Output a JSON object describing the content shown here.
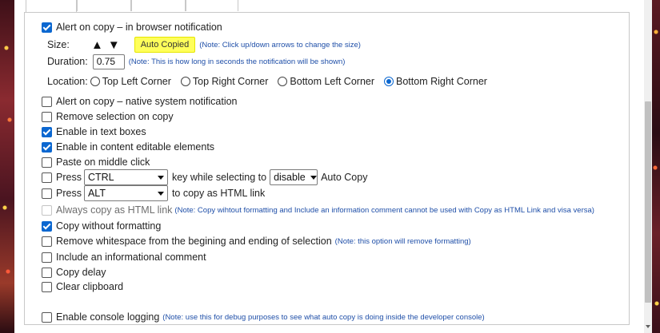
{
  "options": {
    "alert_on_copy_browser": {
      "label": "Alert on copy – in browser notification",
      "checked": true
    },
    "size": {
      "label": "Size:",
      "up_arrow": "▲",
      "down_arrow": "▼",
      "preview_label": "Auto Copied",
      "note": "(Note: Click up/down arrows to change the size)"
    },
    "duration": {
      "label": "Duration:",
      "value": "0.75",
      "note": "(Note: This is how long in seconds the notification will be shown)"
    },
    "location": {
      "label": "Location:",
      "options": [
        {
          "label": "Top Left Corner",
          "selected": false
        },
        {
          "label": "Top Right Corner",
          "selected": false
        },
        {
          "label": "Bottom Left Corner",
          "selected": false
        },
        {
          "label": "Bottom Right Corner",
          "selected": true
        }
      ]
    },
    "alert_on_copy_native": {
      "label": "Alert on copy – native system notification",
      "checked": false
    },
    "remove_selection": {
      "label": "Remove selection on copy",
      "checked": false
    },
    "enable_text_boxes": {
      "label": "Enable in text boxes",
      "checked": true
    },
    "enable_content_editable": {
      "label": "Enable in content editable elements",
      "checked": true
    },
    "paste_middle_click": {
      "label": "Paste on middle click",
      "checked": false
    },
    "press_key_while_selecting": {
      "checked": false,
      "press_label": "Press",
      "key_value": "CTRL",
      "middle_label": "key while selecting to",
      "action_value": "disable",
      "suffix_label": "Auto Copy"
    },
    "press_copy_html": {
      "checked": false,
      "press_label": "Press",
      "key_value": "ALT",
      "suffix_label": "to copy as HTML link"
    },
    "always_copy_html": {
      "label": "Always copy as HTML link",
      "checked": false,
      "disabled": true,
      "note": "(Note: Copy wihtout formatting and Include an information comment cannot be used with Copy as HTML Link and visa versa)"
    },
    "copy_without_formatting": {
      "label": "Copy without formatting",
      "checked": true
    },
    "remove_whitespace": {
      "label": "Remove whitespace from the begining and ending of selection",
      "checked": false,
      "note": "(Note: this option will remove formatting)"
    },
    "include_comment": {
      "label": "Include an informational comment",
      "checked": false
    },
    "copy_delay": {
      "label": "Copy delay",
      "checked": false
    },
    "clear_clipboard": {
      "label": "Clear clipboard",
      "checked": false
    },
    "console_logging": {
      "label": "Enable console logging",
      "checked": false,
      "note": "(Note: use this for debug purposes to see what auto copy is doing inside the developer console)"
    }
  }
}
